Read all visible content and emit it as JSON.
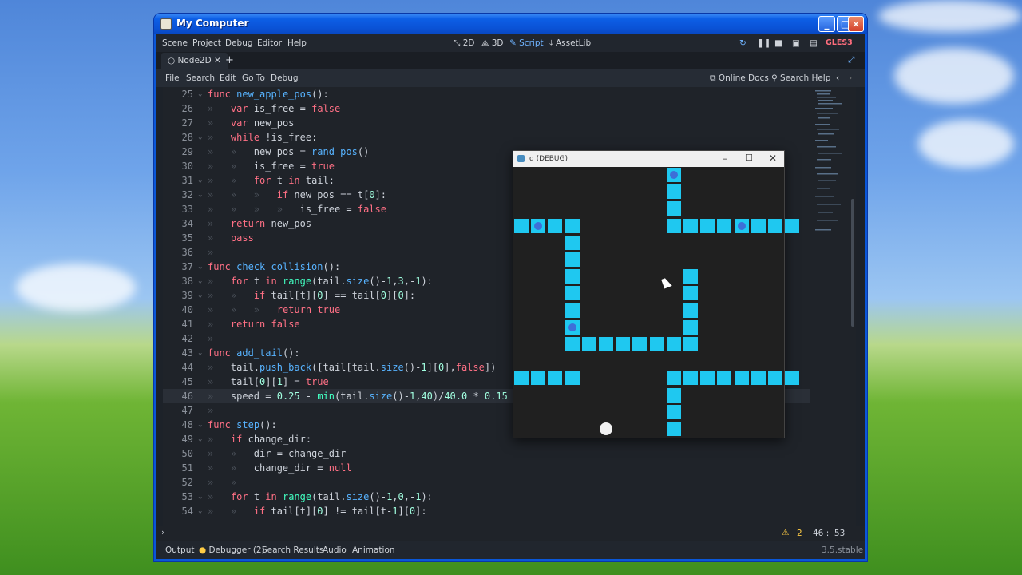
{
  "window": {
    "title": "My Computer"
  },
  "menu": {
    "scene": "Scene",
    "project": "Project",
    "debug": "Debug",
    "editor": "Editor",
    "help": "Help"
  },
  "workspace": {
    "2d": "2D",
    "3d": "3D",
    "script": "Script",
    "assetlib": "AssetLib"
  },
  "renderer": "GLES3",
  "scene_tab": {
    "label": "Node2D",
    "add": "+"
  },
  "script_menu": {
    "file": "File",
    "search": "Search",
    "edit": "Edit",
    "goto": "Go To",
    "debug": "Debug",
    "online_docs": "Online Docs",
    "search_help": "Search Help"
  },
  "code": [
    {
      "n": "25",
      "fold": true,
      "html": "<span class='kw'>func</span> <span class='fn'>new_apple_pos</span>():"
    },
    {
      "n": "26",
      "html": "<span class='tabmark'>»</span>   <span class='kw'>var</span> is_free = <span class='kw'>false</span>"
    },
    {
      "n": "27",
      "html": "<span class='tabmark'>»</span>   <span class='kw'>var</span> new_pos"
    },
    {
      "n": "28",
      "fold": true,
      "html": "<span class='tabmark'>»</span>   <span class='kw'>while</span> !is_free:"
    },
    {
      "n": "29",
      "html": "<span class='tabmark'>»   »</span>   new_pos = <span class='fn'>rand_pos</span>()"
    },
    {
      "n": "30",
      "html": "<span class='tabmark'>»   »</span>   is_free = <span class='kw'>true</span>"
    },
    {
      "n": "31",
      "fold": true,
      "html": "<span class='tabmark'>»   »</span>   <span class='kw'>for</span> t <span class='kw'>in</span> tail:"
    },
    {
      "n": "32",
      "fold": true,
      "html": "<span class='tabmark'>»   »   »</span>   <span class='kw'>if</span> new_pos == t[<span class='num'>0</span>]:"
    },
    {
      "n": "33",
      "html": "<span class='tabmark'>»   »   »   »</span>   is_free = <span class='kw'>false</span>"
    },
    {
      "n": "34",
      "html": "<span class='tabmark'>»</span>   <span class='kw'>return</span> new_pos"
    },
    {
      "n": "35",
      "html": "<span class='tabmark'>»</span>   <span class='kw'>pass</span>"
    },
    {
      "n": "36",
      "html": "<span class='tabmark'>»</span>"
    },
    {
      "n": "37",
      "fold": true,
      "html": "<span class='kw'>func</span> <span class='fn'>check_collision</span>():"
    },
    {
      "n": "38",
      "fold": true,
      "html": "<span class='tabmark'>»</span>   <span class='kw'>for</span> t <span class='kw'>in</span> <span class='bi'>range</span>(tail.<span class='fn'>size</span>()-<span class='num'>1</span>,<span class='num'>3</span>,-<span class='num'>1</span>):"
    },
    {
      "n": "39",
      "fold": true,
      "html": "<span class='tabmark'>»   »</span>   <span class='kw'>if</span> tail[t][<span class='num'>0</span>] == tail[<span class='num'>0</span>][<span class='num'>0</span>]:"
    },
    {
      "n": "40",
      "html": "<span class='tabmark'>»   »   »</span>   <span class='kw'>return</span> <span class='kw'>true</span>"
    },
    {
      "n": "41",
      "html": "<span class='tabmark'>»</span>   <span class='kw'>return</span> <span class='kw'>false</span>"
    },
    {
      "n": "42",
      "html": "<span class='tabmark'>»</span>"
    },
    {
      "n": "43",
      "fold": true,
      "html": "<span class='kw'>func</span> <span class='fn'>add_tail</span>():"
    },
    {
      "n": "44",
      "html": "<span class='tabmark'>»</span>   tail.<span class='fn'>push_back</span>([tail[tail.<span class='fn'>size</span>()-<span class='num'>1</span>][<span class='num'>0</span>],<span class='kw'>false</span>])"
    },
    {
      "n": "45",
      "html": "<span class='tabmark'>»</span>   tail[<span class='num'>0</span>][<span class='num'>1</span>] = <span class='kw'>true</span>"
    },
    {
      "n": "46",
      "cur": true,
      "html": "<span class='tabmark'>»</span>   speed = <span class='num'>0.25</span> - <span class='bi'>min</span>(tail.<span class='fn'>size</span>()-<span class='num'>1</span>,<span class='num'>40</span>)/<span class='num'>40.0</span> * <span class='num'>0.15</span>"
    },
    {
      "n": "47",
      "html": "<span class='tabmark'>»</span>"
    },
    {
      "n": "48",
      "fold": true,
      "html": "<span class='kw'>func</span> <span class='fn'>step</span>():"
    },
    {
      "n": "49",
      "fold": true,
      "html": "<span class='tabmark'>»</span>   <span class='kw'>if</span> change_dir:"
    },
    {
      "n": "50",
      "html": "<span class='tabmark'>»   »</span>   dir = change_dir"
    },
    {
      "n": "51",
      "html": "<span class='tabmark'>»   »</span>   change_dir = <span class='kw'>null</span>"
    },
    {
      "n": "52",
      "html": "<span class='tabmark'>»   »</span>"
    },
    {
      "n": "53",
      "fold": true,
      "html": "<span class='tabmark'>»</span>   <span class='kw'>for</span> t <span class='kw'>in</span> <span class='bi'>range</span>(tail.<span class='fn'>size</span>()-<span class='num'>1</span>,<span class='num'>0</span>,-<span class='num'>1</span>):"
    },
    {
      "n": "54",
      "fold": true,
      "html": "<span class='tabmark'>»   »</span>   <span class='kw'>if</span> tail[t][<span class='num'>0</span>] != tail[t-<span class='num'>1</span>][<span class='num'>0</span>]:"
    }
  ],
  "status": {
    "warnings": "2",
    "cursor": "46 :  53",
    "expand": "›"
  },
  "bottom": {
    "output": "Output",
    "debugger": "Debugger (2)",
    "search_results": "Search Results",
    "audio": "Audio",
    "animation": "Animation",
    "version": "3.5.stable"
  },
  "game": {
    "title": "d (DEBUG)",
    "tiles": [
      [
        9,
        0
      ],
      [
        9,
        1
      ],
      [
        9,
        2
      ],
      [
        0,
        3
      ],
      [
        1,
        3
      ],
      [
        2,
        3
      ],
      [
        3,
        3
      ],
      [
        9,
        3
      ],
      [
        10,
        3
      ],
      [
        11,
        3
      ],
      [
        12,
        3
      ],
      [
        13,
        3
      ],
      [
        14,
        3
      ],
      [
        15,
        3
      ],
      [
        16,
        3
      ],
      [
        3,
        4
      ],
      [
        3,
        5
      ],
      [
        3,
        6
      ],
      [
        3,
        7
      ],
      [
        3,
        8
      ],
      [
        3,
        9
      ],
      [
        3,
        10
      ],
      [
        4,
        10
      ],
      [
        5,
        10
      ],
      [
        6,
        10
      ],
      [
        7,
        10
      ],
      [
        8,
        10
      ],
      [
        9,
        10
      ],
      [
        10,
        10
      ],
      [
        10,
        6
      ],
      [
        10,
        7
      ],
      [
        10,
        8
      ],
      [
        10,
        9
      ],
      [
        0,
        12
      ],
      [
        1,
        12
      ],
      [
        2,
        12
      ],
      [
        3,
        12
      ],
      [
        9,
        12
      ],
      [
        10,
        12
      ],
      [
        11,
        12
      ],
      [
        12,
        12
      ],
      [
        13,
        12
      ],
      [
        14,
        12
      ],
      [
        15,
        12
      ],
      [
        16,
        12
      ],
      [
        9,
        13
      ],
      [
        9,
        14
      ],
      [
        9,
        15
      ]
    ],
    "apples": [
      [
        9,
        0
      ],
      [
        1,
        3
      ],
      [
        13,
        3
      ],
      [
        3,
        9
      ]
    ],
    "ball": [
      5,
      15
    ]
  }
}
